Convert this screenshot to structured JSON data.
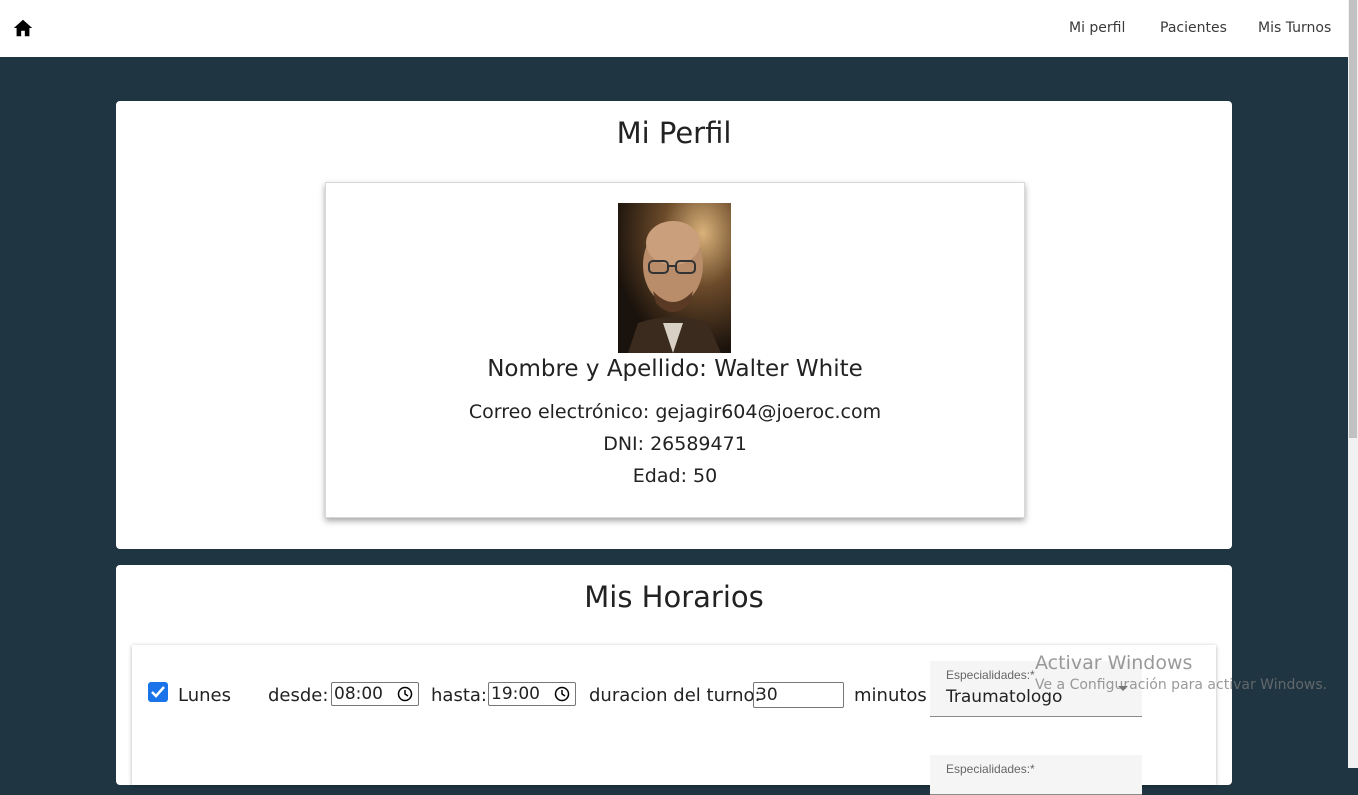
{
  "nav": {
    "home_icon": "home-icon",
    "links": [
      "Mi perfil",
      "Pacientes",
      "Mis Turnos"
    ]
  },
  "profile": {
    "title": "Mi Perfil",
    "photo": "portrait-photo",
    "fullname": "Nombre y Apellido: Walter White",
    "email": "Correo electrónico: gejagir604@joeroc.com",
    "dni": "DNI: 26589471",
    "age": "Edad: 50"
  },
  "schedule": {
    "title": "Mis Horarios",
    "rows": [
      {
        "checked": true,
        "day": "Lunes",
        "from_label": "desde:",
        "from_value": "08:00",
        "to_label": "hasta:",
        "to_value": "19:00",
        "duration_label": "duracion del turno:",
        "duration_value": "30",
        "duration_unit": "minutos",
        "specialty_label": "Especialidades:*",
        "specialty_value": "Traumatologo"
      }
    ],
    "next_specialty_label": "Especialidades:*"
  },
  "watermark": {
    "title": "Activar Windows",
    "subtitle": "Ve a Configuración para activar Windows."
  },
  "colors": {
    "background": "#1f3542",
    "checkbox": "#1a73e8",
    "panel": "#ffffff"
  }
}
